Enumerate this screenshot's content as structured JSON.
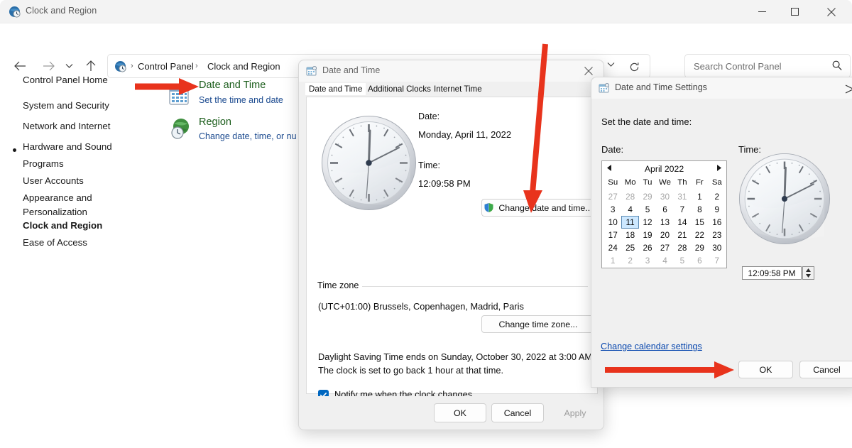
{
  "window": {
    "title": "Clock and Region",
    "icon": "clock-region-icon",
    "controls": {
      "minimize": "–",
      "maximize": "☐",
      "close": "✕"
    }
  },
  "toolbar": {
    "back_icon": "←",
    "forward_icon": "→",
    "recent_icon": "⌄",
    "up_icon": "↑",
    "breadcrumb": {
      "root_icon": "control-panel-icon",
      "sep": "›",
      "items": [
        "Control Panel",
        "Clock and Region"
      ]
    },
    "chevron": "⌄",
    "refresh_icon": "⟳"
  },
  "search": {
    "placeholder": "Search Control Panel",
    "icon": "search-icon"
  },
  "sidebar": {
    "home": "Control Panel Home",
    "items": [
      {
        "label": "System and Security",
        "selected": false
      },
      {
        "label": "Network and Internet",
        "selected": false
      },
      {
        "label": "Hardware and Sound",
        "selected": false
      },
      {
        "label": "Programs",
        "selected": false
      },
      {
        "label": "User Accounts",
        "selected": false
      },
      {
        "label": "Appearance and",
        "selected": false
      },
      {
        "label": "Personalization",
        "selected": false
      },
      {
        "label": "Clock and Region",
        "selected": true
      },
      {
        "label": "Ease of Access",
        "selected": false
      }
    ]
  },
  "categories": [
    {
      "title": "Date and Time",
      "subtitle": "Set the time and date",
      "icon": "calendar-icon"
    },
    {
      "title": "Region",
      "subtitle": "Change date, time, or nu",
      "icon": "region-globe-icon"
    }
  ],
  "date_time_dialog": {
    "title": "Date and Time",
    "icon": "date-time-icon",
    "close": "✕",
    "tabs": [
      {
        "label": "Date and Time",
        "active": true
      },
      {
        "label": "Additional Clocks",
        "active": false
      },
      {
        "label": "Internet Time",
        "active": false
      }
    ],
    "date_label": "Date:",
    "date_value": "Monday, April 11, 2022",
    "time_label": "Time:",
    "time_value": "12:09:58 PM",
    "change_datetime_button": "Change date and time...",
    "shield_icon": "uac-shield-icon",
    "timezone_legend": "Time zone",
    "timezone_value": "(UTC+01:00) Brussels, Copenhagen, Madrid, Paris",
    "change_timezone_button": "Change time zone...",
    "dst_line_1": "Daylight Saving Time ends on Sunday, October 30, 2022 at 3:00 AM.",
    "dst_line_2": "The clock is set to go back 1 hour at that time.",
    "notify_checkbox_label": "Notify me when the clock changes",
    "notify_checked": true,
    "footer_buttons": [
      {
        "label": "OK",
        "disabled": false
      },
      {
        "label": "Cancel",
        "disabled": false
      },
      {
        "label": "Apply",
        "disabled": true
      }
    ],
    "clock": {
      "hour": 12,
      "minute": 9,
      "second": 58
    }
  },
  "settings_dialog": {
    "title": "Date and Time Settings",
    "icon": "date-time-settings-icon",
    "close": "✕",
    "prompt": "Set the date and time:",
    "date_label": "Date:",
    "time_label": "Time:",
    "calendar": {
      "month_year": "April 2022",
      "prev_icon": "◀",
      "next_icon": "▶",
      "day_headers": [
        "Su",
        "Mo",
        "Tu",
        "We",
        "Th",
        "Fr",
        "Sa"
      ],
      "weeks": [
        [
          {
            "d": "27",
            "o": true
          },
          {
            "d": "28",
            "o": true
          },
          {
            "d": "29",
            "o": true
          },
          {
            "d": "30",
            "o": true
          },
          {
            "d": "31",
            "o": true
          },
          {
            "d": "1",
            "o": false
          },
          {
            "d": "2",
            "o": false
          }
        ],
        [
          {
            "d": "3",
            "o": false
          },
          {
            "d": "4",
            "o": false
          },
          {
            "d": "5",
            "o": false
          },
          {
            "d": "6",
            "o": false
          },
          {
            "d": "7",
            "o": false
          },
          {
            "d": "8",
            "o": false
          },
          {
            "d": "9",
            "o": false
          }
        ],
        [
          {
            "d": "10",
            "o": false
          },
          {
            "d": "11",
            "o": false,
            "sel": true
          },
          {
            "d": "12",
            "o": false
          },
          {
            "d": "13",
            "o": false
          },
          {
            "d": "14",
            "o": false
          },
          {
            "d": "15",
            "o": false
          },
          {
            "d": "16",
            "o": false
          }
        ],
        [
          {
            "d": "17",
            "o": false
          },
          {
            "d": "18",
            "o": false
          },
          {
            "d": "19",
            "o": false
          },
          {
            "d": "20",
            "o": false
          },
          {
            "d": "21",
            "o": false
          },
          {
            "d": "22",
            "o": false
          },
          {
            "d": "23",
            "o": false
          }
        ],
        [
          {
            "d": "24",
            "o": false
          },
          {
            "d": "25",
            "o": false
          },
          {
            "d": "26",
            "o": false
          },
          {
            "d": "27",
            "o": false
          },
          {
            "d": "28",
            "o": false
          },
          {
            "d": "29",
            "o": false
          },
          {
            "d": "30",
            "o": false
          }
        ],
        [
          {
            "d": "1",
            "o": true
          },
          {
            "d": "2",
            "o": true
          },
          {
            "d": "3",
            "o": true
          },
          {
            "d": "4",
            "o": true
          },
          {
            "d": "5",
            "o": true
          },
          {
            "d": "6",
            "o": true
          },
          {
            "d": "7",
            "o": true
          }
        ]
      ],
      "selected_day": "11"
    },
    "time_value": "12:09:58 PM",
    "spin_up": "▲",
    "spin_down": "▼",
    "calendar_settings_link": "Change calendar settings",
    "buttons": [
      {
        "label": "OK"
      },
      {
        "label": "Cancel"
      }
    ],
    "clock": {
      "hour": 12,
      "minute": 9,
      "second": 58
    }
  },
  "annotations": {
    "color": "#e8331c",
    "arrows": [
      {
        "name": "arrow-to-date-and-time",
        "target": "Date and Time category link"
      },
      {
        "name": "arrow-to-change-date-and-time",
        "target": "Change date and time... button"
      },
      {
        "name": "arrow-to-settings-ok",
        "target": "OK button of Date and Time Settings"
      }
    ]
  }
}
